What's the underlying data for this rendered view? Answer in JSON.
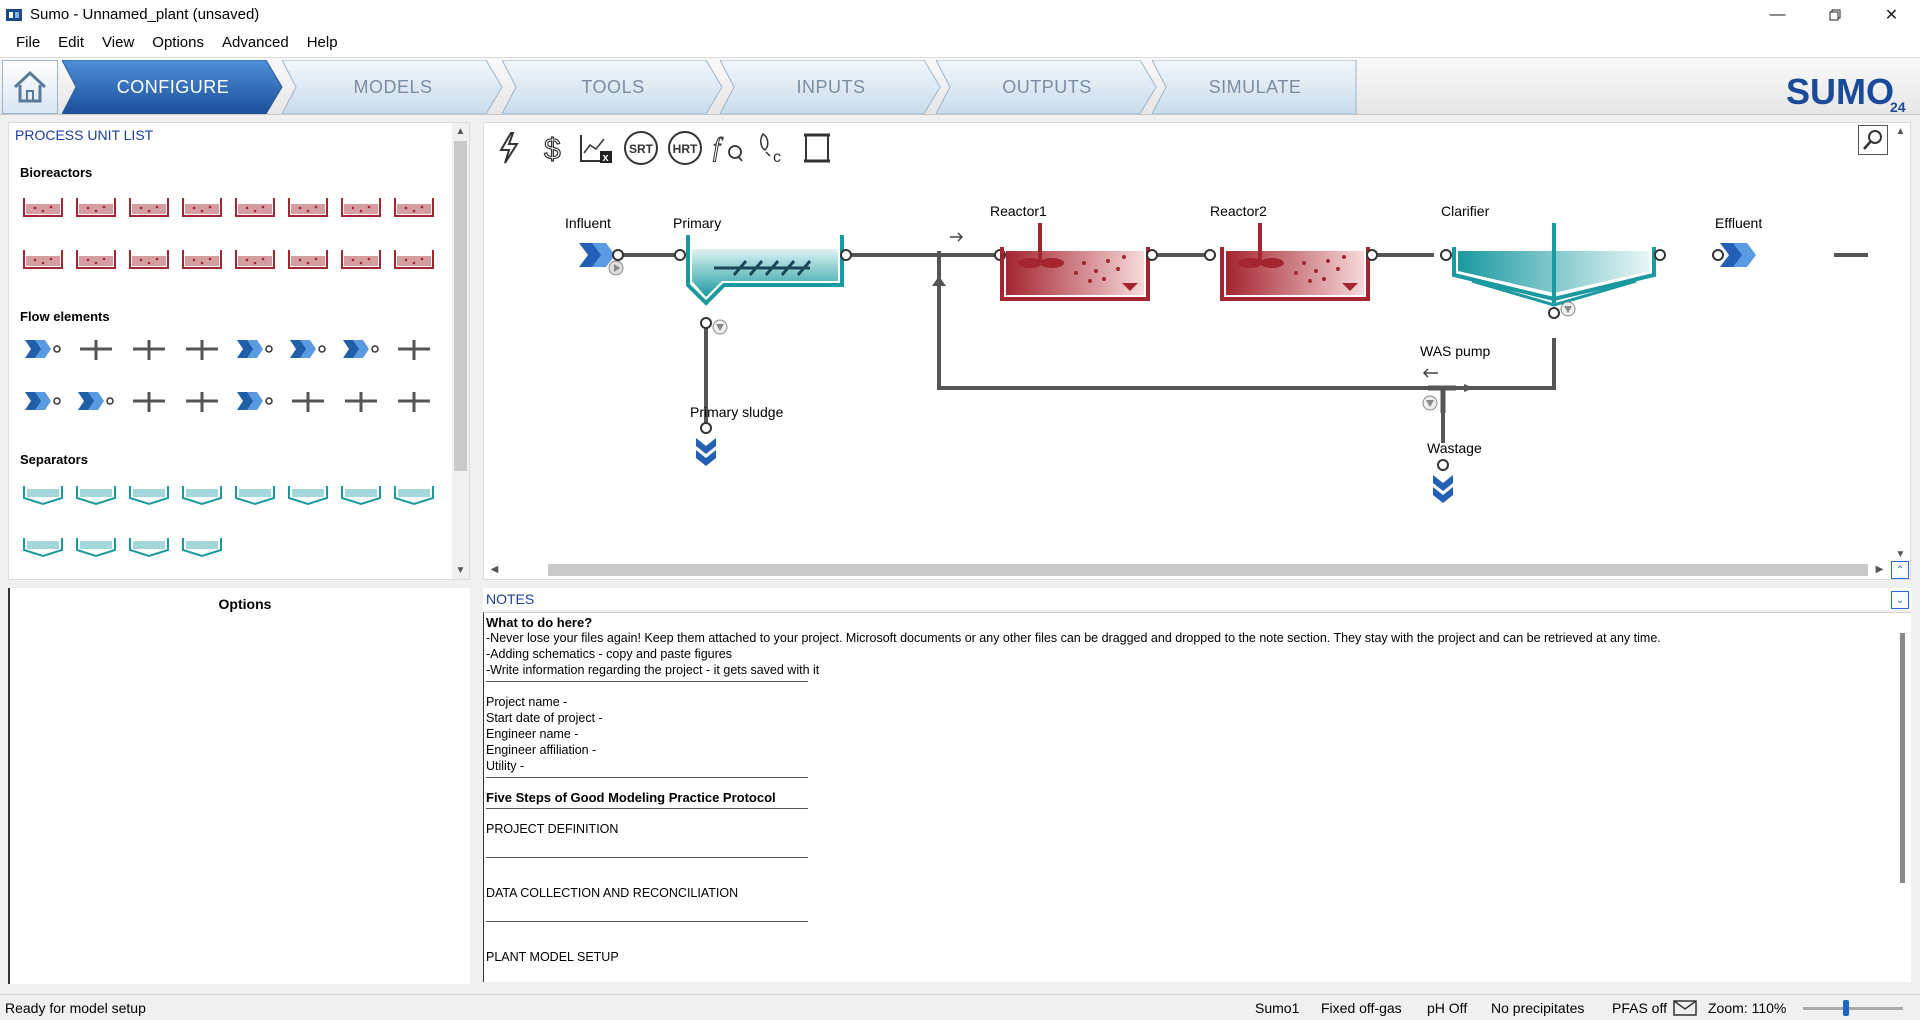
{
  "window": {
    "title": "Sumo - Unnamed_plant (unsaved)",
    "controls": [
      "minimize-icon",
      "restore-icon",
      "close-icon"
    ]
  },
  "menu": [
    "File",
    "Edit",
    "View",
    "Options",
    "Advanced",
    "Help"
  ],
  "nav": {
    "tabs": [
      "CONFIGURE",
      "MODELS",
      "TOOLS",
      "INPUTS",
      "OUTPUTS",
      "SIMULATE"
    ],
    "active": "CONFIGURE",
    "logo_text": "SUMO",
    "logo_version": "24"
  },
  "process_unit_list": {
    "title": "PROCESS UNIT LIST",
    "sections": [
      {
        "label": "Bioreactors",
        "count": 16
      },
      {
        "label": "Flow elements",
        "count": 16
      },
      {
        "label": "Separators",
        "count": 12
      }
    ]
  },
  "options_panel": {
    "title": "Options"
  },
  "canvas_toolbar": {
    "icons": [
      "lightning-icon",
      "dollar-icon",
      "table-x-icon",
      "srt-icon",
      "hrt-icon",
      "fq-icon",
      "footprint-c-icon",
      "scroll-icon"
    ],
    "srt_label": "SRT",
    "hrt_label": "HRT"
  },
  "flowsheet": {
    "units": {
      "influent": "Influent",
      "primary": "Primary",
      "reactor1": "Reactor1",
      "reactor2": "Reactor2",
      "clarifier": "Clarifier",
      "effluent": "Effluent",
      "primary_sludge": "Primary sludge",
      "was_pump": "WAS pump",
      "wastage": "Wastage"
    }
  },
  "notes": {
    "title": "NOTES",
    "lines": {
      "heading": "What to do here?",
      "l1": "-Never lose your files again! Keep them attached to your project. Microsoft documents or any other files can be dragged and dropped to the note section. They stay with the project and can be retrieved at any time.",
      "l2": "-Adding schematics - copy and paste figures",
      "l3": "-Write information regarding the project - it gets saved with it",
      "project_name": "Project name -",
      "start_date": "Start date of project -",
      "engineer_name": "Engineer name -",
      "engineer_aff": "Engineer affiliation -",
      "utility": "Utility -",
      "protocol": "Five Steps of Good Modeling Practice Protocol",
      "step1": "PROJECT DEFINITION",
      "step2": "DATA COLLECTION AND RECONCILIATION",
      "step3": "PLANT MODEL SETUP"
    }
  },
  "status": {
    "message": "Ready for model setup",
    "model": "Sumo1",
    "offgas": "Fixed off-gas",
    "ph": "pH Off",
    "precip": "No precipitates",
    "pfas": "PFAS off",
    "zoom": "Zoom: 110%",
    "zoom_level": 0.42
  },
  "colors": {
    "accent_blue": "#1e5fa8",
    "teal": "#1a9aa0",
    "reactor_red": "#a3252f",
    "pipe": "#555555"
  }
}
